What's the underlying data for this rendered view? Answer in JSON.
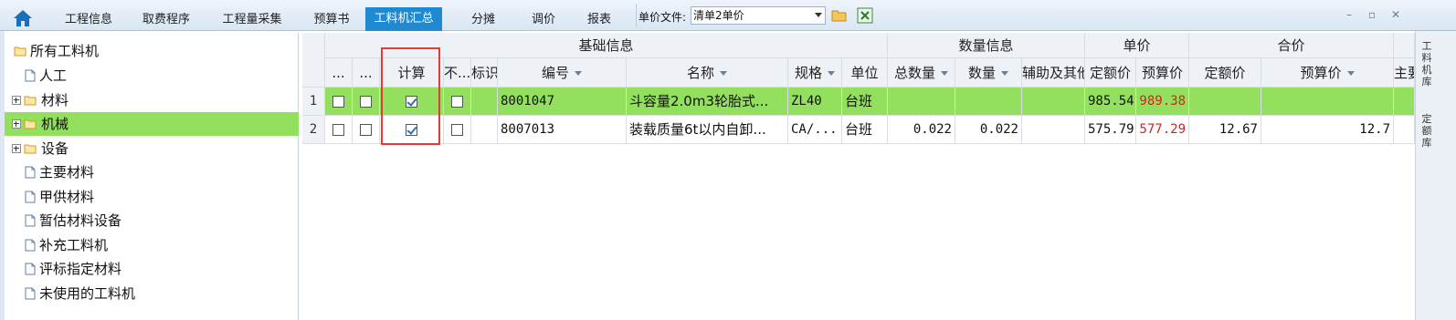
{
  "top_tabs": [
    "工程信息",
    "取费程序",
    "工程量采集",
    "预算书",
    "工料机汇总",
    "分摊",
    "调价",
    "报表"
  ],
  "active_tab": "工料机汇总",
  "price_file": {
    "label": "单价文件:",
    "value": "清单2单价"
  },
  "window_controls": {
    "minimize": "–",
    "restore": "▫",
    "close": "✕"
  },
  "tree": {
    "root": "所有工料机",
    "items": [
      {
        "label": "人工",
        "expandable": false,
        "folder": false
      },
      {
        "label": "材料",
        "expandable": true,
        "folder": true
      },
      {
        "label": "机械",
        "expandable": true,
        "folder": true,
        "selected": true
      },
      {
        "label": "设备",
        "expandable": true,
        "folder": true
      },
      {
        "label": "主要材料",
        "expandable": false,
        "folder": false
      },
      {
        "label": "甲供材料",
        "expandable": false,
        "folder": false
      },
      {
        "label": "暂估材料设备",
        "expandable": false,
        "folder": false
      },
      {
        "label": "补充工料机",
        "expandable": false,
        "folder": false
      },
      {
        "label": "评标指定材料",
        "expandable": false,
        "folder": false
      },
      {
        "label": "未使用的工料机",
        "expandable": false,
        "folder": false
      }
    ]
  },
  "grid": {
    "groups": {
      "basic": "基础信息",
      "quantity": "数量信息",
      "unit_price": "单价",
      "total_price": "合价"
    },
    "columns": {
      "c1": "...",
      "c2": "...",
      "calc": "计算",
      "not": "不...",
      "mark": "标识",
      "code": "编号",
      "name": "名称",
      "spec": "规格",
      "unit": "单位",
      "total_qty": "总数量",
      "qty": "数量",
      "aux": "辅助及其他",
      "quota_price": "定额价",
      "budget_price": "预算价",
      "total_quota": "定额价",
      "total_budget": "预算价",
      "main": "主要"
    },
    "rows": [
      {
        "no": "1",
        "c1": false,
        "c2": false,
        "calc": true,
        "not": false,
        "mark": "",
        "code": "8001047",
        "name": "斗容量2.0m3轮胎式...",
        "spec": "ZL40",
        "unit": "台班",
        "total_qty": "",
        "qty": "",
        "aux": "",
        "quota_price": "985.54",
        "budget_price": "989.38",
        "total_quota": "",
        "total_budget": ""
      },
      {
        "no": "2",
        "c1": false,
        "c2": false,
        "calc": true,
        "not": false,
        "mark": "",
        "code": "8007013",
        "name": "装载质量6t以内自卸...",
        "spec": "CA/...",
        "unit": "台班",
        "total_qty": "0.022",
        "qty": "0.022",
        "aux": "",
        "quota_price": "575.79",
        "budget_price": "577.29",
        "total_quota": "12.67",
        "total_budget": "12.7"
      }
    ]
  },
  "side_tabs": [
    "工料机库",
    "定额库"
  ]
}
